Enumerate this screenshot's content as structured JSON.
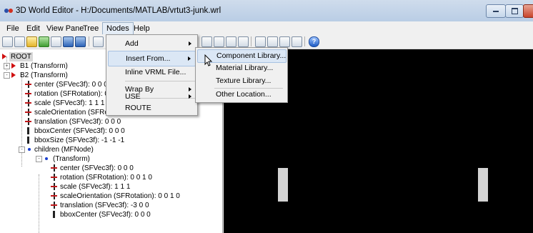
{
  "window": {
    "title": "3D World Editor - H:/Documents/MATLAB/vrtut3-junk.wrl"
  },
  "menubar": [
    "File",
    "Edit",
    "View Pane",
    "Tree",
    "Nodes",
    "Help"
  ],
  "nodes_menu": [
    "Add",
    "Insert From...",
    "Inline VRML File...",
    "Wrap By",
    "USE",
    "ROUTE"
  ],
  "insert_from_submenu": [
    "Component Library...",
    "Material Library...",
    "Texture Library...",
    "Other Location..."
  ],
  "tree": [
    {
      "label": "ROOT",
      "level": 0,
      "icon": "root-triangle-icon",
      "selected": true
    },
    {
      "label": "B1 (Transform)",
      "level": 0,
      "icon": "node-triangle-icon",
      "expander": "+"
    },
    {
      "label": "B2 (Transform)",
      "level": 0,
      "icon": "node-triangle-icon",
      "expander": "-"
    },
    {
      "label": "center (SFVec3f): 0 0 0",
      "level": 1,
      "icon": "field-icon"
    },
    {
      "label": "rotation (SFRotation): 0",
      "level": 1,
      "icon": "field-icon"
    },
    {
      "label": "scale (SFVec3f): 1 1 1",
      "level": 1,
      "icon": "field-icon"
    },
    {
      "label": "scaleOrientation (SFRotation): 0 0 1 0",
      "level": 1,
      "icon": "field-icon"
    },
    {
      "label": "translation (SFVec3f): 0 0 0",
      "level": 1,
      "icon": "field-icon"
    },
    {
      "label": "bboxCenter (SFVec3f): 0 0 0",
      "level": 1,
      "icon": "bar-icon"
    },
    {
      "label": "bboxSize (SFVec3f): -1 -1 -1",
      "level": 1,
      "icon": "bar-icon"
    },
    {
      "label": "children (MFNode)",
      "level": 1,
      "icon": "dot-icon",
      "expander": "-"
    },
    {
      "label": "(Transform)",
      "level": 2,
      "icon": "dot-icon",
      "expander": "-"
    },
    {
      "label": "center (SFVec3f): 0 0 0",
      "level": 3,
      "icon": "field-icon"
    },
    {
      "label": "rotation (SFRotation): 0 0 1 0",
      "level": 3,
      "icon": "field-icon"
    },
    {
      "label": "scale (SFVec3f): 1 1 1",
      "level": 3,
      "icon": "field-icon"
    },
    {
      "label": "scaleOrientation (SFRotation): 0 0 1 0",
      "level": 3,
      "icon": "field-icon"
    },
    {
      "label": "translation (SFVec3f): -3 0 0",
      "level": 3,
      "icon": "field-icon"
    },
    {
      "label": "bboxCenter (SFVec3f): 0 0 0",
      "level": 3,
      "icon": "bar-icon"
    }
  ],
  "colors": {
    "viewport_bg": "#000000",
    "scene_objects": "#d3d3d3",
    "node_marker": "#d01010"
  }
}
